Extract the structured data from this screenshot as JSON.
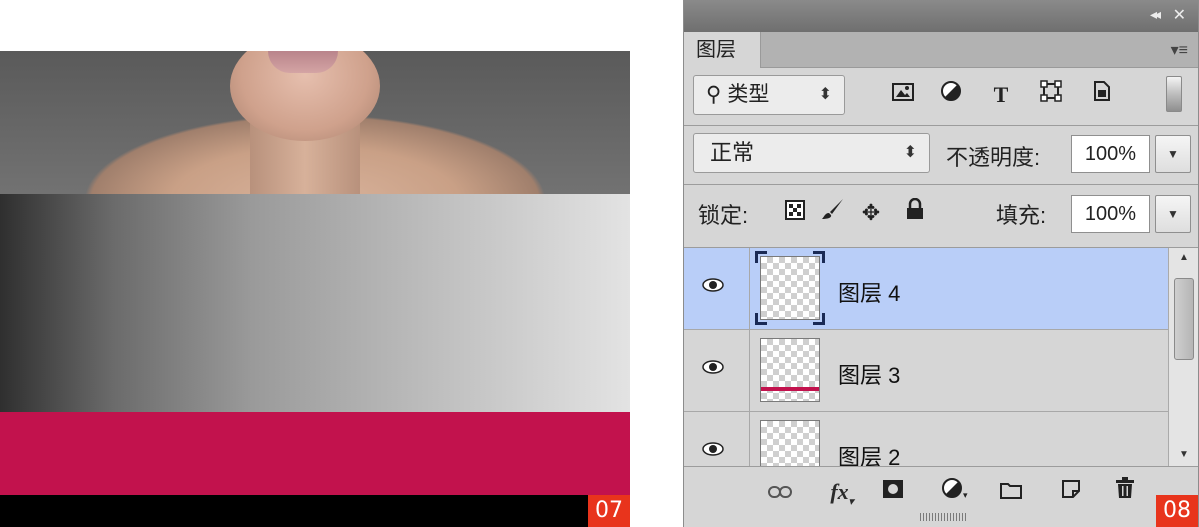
{
  "figures": {
    "left_number": "07",
    "right_number": "08"
  },
  "colors": {
    "accent_red": "#c2124d",
    "figure_badge": "#e8341c",
    "selected_row": "#b9cef8"
  },
  "panel": {
    "tab_label": "图层",
    "filter": {
      "kind_icon": "search-icon",
      "kind_label": "类型"
    },
    "filter_icons": [
      "image-filter-icon",
      "adjustment-filter-icon",
      "type-filter-icon",
      "shape-filter-icon",
      "smart-object-filter-icon"
    ],
    "blend_mode": "正常",
    "opacity_label": "不透明度:",
    "opacity_value": "100%",
    "lock_label": "锁定:",
    "fill_label": "填充:",
    "fill_value": "100%",
    "layers": [
      {
        "name": "图层 4",
        "selected": true
      },
      {
        "name": "图层 3",
        "selected": false
      },
      {
        "name": "图层 2",
        "selected": false
      }
    ],
    "toolbar_icons": [
      "link-layers-icon",
      "fx-icon",
      "add-mask-icon",
      "adjustment-layer-icon",
      "new-group-icon",
      "new-layer-icon",
      "delete-layer-icon"
    ]
  }
}
